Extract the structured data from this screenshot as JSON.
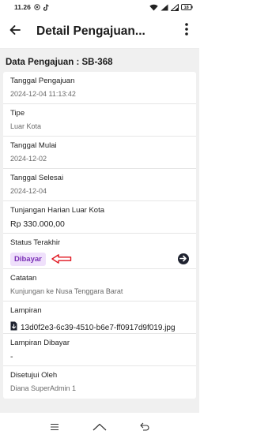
{
  "status_bar": {
    "time": "11.26",
    "battery": "18"
  },
  "header": {
    "title": "Detail Pengajuan..."
  },
  "section_title": "Data Pengajuan : SB-368",
  "fields": {
    "tanggal_pengajuan": {
      "label": "Tanggal Pengajuan",
      "value": "2024-12-04 11:13:42"
    },
    "tipe": {
      "label": "Tipe",
      "value": "Luar Kota"
    },
    "tanggal_mulai": {
      "label": "Tanggal Mulai",
      "value": "2024-12-02"
    },
    "tanggal_selesai": {
      "label": "Tanggal Selesai",
      "value": "2024-12-04"
    },
    "tunjangan": {
      "label": "Tunjangan Harian Luar Kota",
      "value": "Rp 330.000,00"
    },
    "status": {
      "label": "Status Terakhir",
      "value": "Dibayar"
    },
    "catatan": {
      "label": "Catatan",
      "value": "Kunjungan ke Nusa Tenggara Barat"
    },
    "lampiran": {
      "label": "Lampiran",
      "value": "13d0f2e3-6c39-4510-b6e7-ff0917d9f019.jpg"
    },
    "lampiran_dibayar": {
      "label": "Lampiran Dibayar",
      "value": "-"
    },
    "disetujui_oleh": {
      "label": "Disetujui Oleh",
      "value": "Diana SuperAdmin 1"
    }
  },
  "colors": {
    "badge_bg": "#efe0fb",
    "badge_text": "#7a2fb6",
    "annotation_arrow": "#e0141e",
    "content_bg": "#f0f0f0"
  },
  "icons": {
    "back": "arrow-left-icon",
    "more": "more-vertical-icon",
    "go": "arrow-right-circle-icon",
    "file": "file-download-icon"
  }
}
